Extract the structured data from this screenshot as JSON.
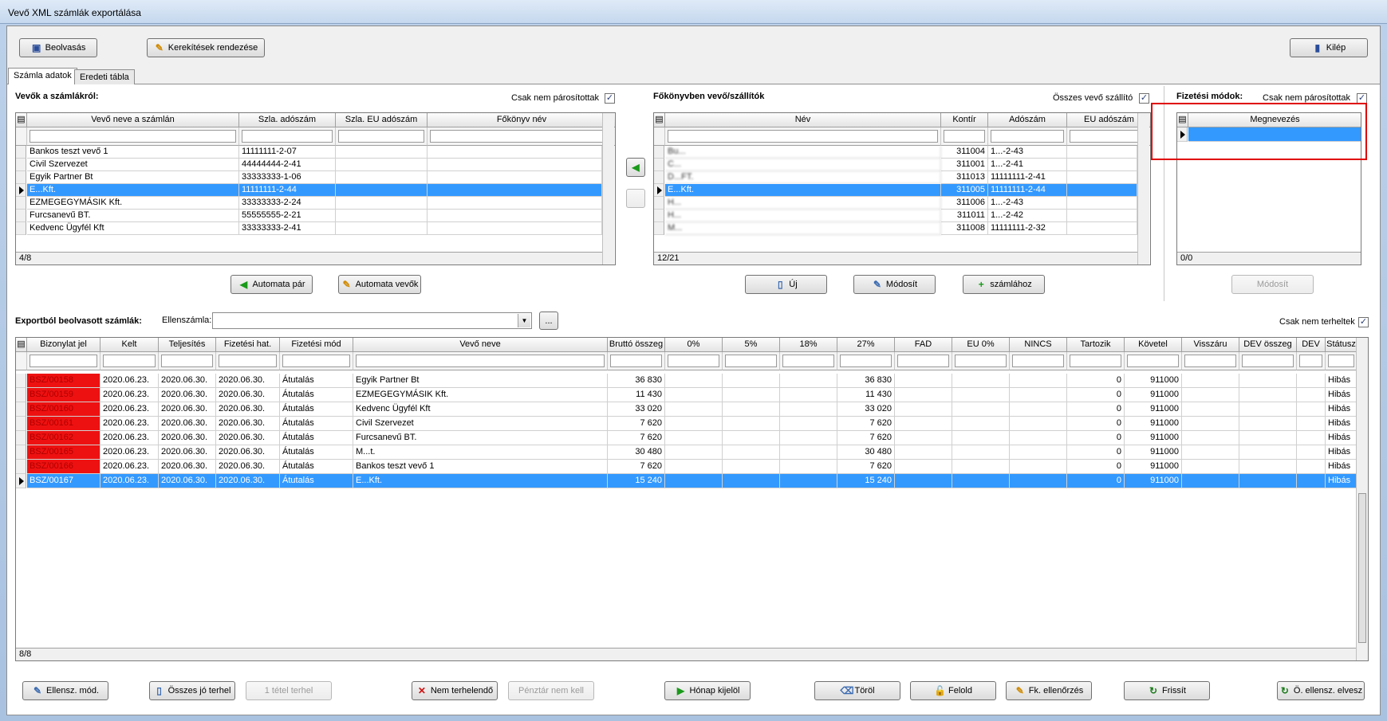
{
  "window": {
    "title": "Vevő XML számlák exportálása"
  },
  "toolbar": {
    "read": "Beolvasás",
    "rounding": "Kerekítések rendezése",
    "exit": "Kilép"
  },
  "tabs": [
    "Számla adatok",
    "Eredeti tábla"
  ],
  "customers": {
    "title": "Vevők a számlákról:",
    "only_unpaired": "Csak nem párosítottak",
    "columns": [
      "Vevő neve a számlán",
      "Szla. adószám",
      "Szla. EU adószám",
      "Főkönyv név"
    ],
    "rows": [
      {
        "name": "Bankos teszt vevő 1",
        "tax": "11111111-2-07"
      },
      {
        "name": "Civil Szervezet",
        "tax": "44444444-2-41"
      },
      {
        "name": "Egyik Partner Bt",
        "tax": "33333333-1-06"
      },
      {
        "name": "E...Kft.",
        "tax": "11111111-2-44",
        "selected": true
      },
      {
        "name": "EZMEGEGYMÁSIK Kft.",
        "tax": "33333333-2-24"
      },
      {
        "name": "Furcsanevű BT.",
        "tax": "55555555-2-21"
      },
      {
        "name": "Kedvenc Ügyfél Kft",
        "tax": "33333333-2-41"
      }
    ],
    "count": "4/8",
    "auto_pair": "Automata pár",
    "auto_customers": "Automata vevők"
  },
  "ledger": {
    "title": "Főkönyvben vevő/szállítók",
    "all_label": "Összes vevő szállító",
    "columns": [
      "Név",
      "Kontír",
      "Adószám",
      "EU adószám"
    ],
    "rows": [
      {
        "name": "Bu...",
        "kontir": "311004",
        "tax": "1...-2-43"
      },
      {
        "name": "C...",
        "kontir": "311001",
        "tax": "1...-2-41"
      },
      {
        "name": "D...FT.",
        "kontir": "311013",
        "tax": "11111111-2-41"
      },
      {
        "name": "E...Kft.",
        "kontir": "311005",
        "tax": "11111111-2-44",
        "selected": true
      },
      {
        "name": "H...",
        "kontir": "311006",
        "tax": "1...-2-43"
      },
      {
        "name": "H...",
        "kontir": "311011",
        "tax": "1...-2-42"
      },
      {
        "name": "M...",
        "kontir": "311008",
        "tax": "11111111-2-32"
      }
    ],
    "count": "12/21",
    "new": "Új",
    "modify": "Módosít",
    "to_invoice": "számlához"
  },
  "payment": {
    "title": "Fizetési módok:",
    "only_unpaired": "Csak nem párosítottak",
    "column": "Megnevezés",
    "count": "0/0",
    "modify": "Módosít"
  },
  "invoices": {
    "title": "Exportból beolvasott számlák:",
    "counter_label": "Ellenszámla:",
    "browse": "...",
    "only_not_charged": "Csak nem terheltek",
    "columns": [
      "Bizonylat jel",
      "Kelt",
      "Teljesítés",
      "Fizetési hat.",
      "Fizetési mód",
      "Vevő neve",
      "Bruttó összeg",
      "0%",
      "5%",
      "18%",
      "27%",
      "FAD",
      "EU 0%",
      "NINCS",
      "Tartozik",
      "Követel",
      "Visszáru",
      "DEV összeg",
      "DEV",
      "Státusz"
    ],
    "rows": [
      {
        "id": "BSZ/00158",
        "kelt": "2020.06.23.",
        "telj": "2020.06.30.",
        "hat": "2020.06.30.",
        "mod": "Átutalás",
        "vevo": "Egyik Partner Bt",
        "brutto": "36 830",
        "p27": "36 830",
        "tartozik": "0",
        "kovetel": "911000",
        "status": "Hibás"
      },
      {
        "id": "BSZ/00159",
        "kelt": "2020.06.23.",
        "telj": "2020.06.30.",
        "hat": "2020.06.30.",
        "mod": "Átutalás",
        "vevo": "EZMEGEGYMÁSIK Kft.",
        "brutto": "11 430",
        "p27": "11 430",
        "tartozik": "0",
        "kovetel": "911000",
        "status": "Hibás"
      },
      {
        "id": "BSZ/00160",
        "kelt": "2020.06.23.",
        "telj": "2020.06.30.",
        "hat": "2020.06.30.",
        "mod": "Átutalás",
        "vevo": "Kedvenc Ügyfél Kft",
        "brutto": "33 020",
        "p27": "33 020",
        "tartozik": "0",
        "kovetel": "911000",
        "status": "Hibás"
      },
      {
        "id": "BSZ/00161",
        "kelt": "2020.06.23.",
        "telj": "2020.06.30.",
        "hat": "2020.06.30.",
        "mod": "Átutalás",
        "vevo": "Civil Szervezet",
        "brutto": "7 620",
        "p27": "7 620",
        "tartozik": "0",
        "kovetel": "911000",
        "status": "Hibás"
      },
      {
        "id": "BSZ/00162",
        "kelt": "2020.06.23.",
        "telj": "2020.06.30.",
        "hat": "2020.06.30.",
        "mod": "Átutalás",
        "vevo": "Furcsanevű BT.",
        "brutto": "7 620",
        "p27": "7 620",
        "tartozik": "0",
        "kovetel": "911000",
        "status": "Hibás"
      },
      {
        "id": "BSZ/00165",
        "kelt": "2020.06.23.",
        "telj": "2020.06.30.",
        "hat": "2020.06.30.",
        "mod": "Átutalás",
        "vevo": "M...t.",
        "brutto": "30 480",
        "p27": "30 480",
        "tartozik": "0",
        "kovetel": "911000",
        "status": "Hibás"
      },
      {
        "id": "BSZ/00166",
        "kelt": "2020.06.23.",
        "telj": "2020.06.30.",
        "hat": "2020.06.30.",
        "mod": "Átutalás",
        "vevo": "Bankos teszt vevő 1",
        "brutto": "7 620",
        "p27": "7 620",
        "tartozik": "0",
        "kovetel": "911000",
        "status": "Hibás"
      },
      {
        "id": "BSZ/00167",
        "kelt": "2020.06.23.",
        "telj": "2020.06.30.",
        "hat": "2020.06.30.",
        "mod": "Átutalás",
        "vevo": "E...Kft.",
        "brutto": "15 240",
        "p27": "15 240",
        "tartozik": "0",
        "kovetel": "911000",
        "status": "Hibás",
        "selected": true
      }
    ],
    "count": "8/8"
  },
  "bottom": [
    "Ellensz. mód.",
    "Összes jó terhel",
    "1 tétel terhel",
    "Nem terhelendő",
    "Pénztár nem kell",
    "Hónap kijelöl",
    "Töröl",
    "Felold",
    "Fk. ellenőrzés",
    "Frissít",
    "Ö. ellensz. elvesz"
  ],
  "colors": {
    "selection": "#3399ff",
    "error": "#ee1111",
    "highlight_box": "#e00000"
  }
}
